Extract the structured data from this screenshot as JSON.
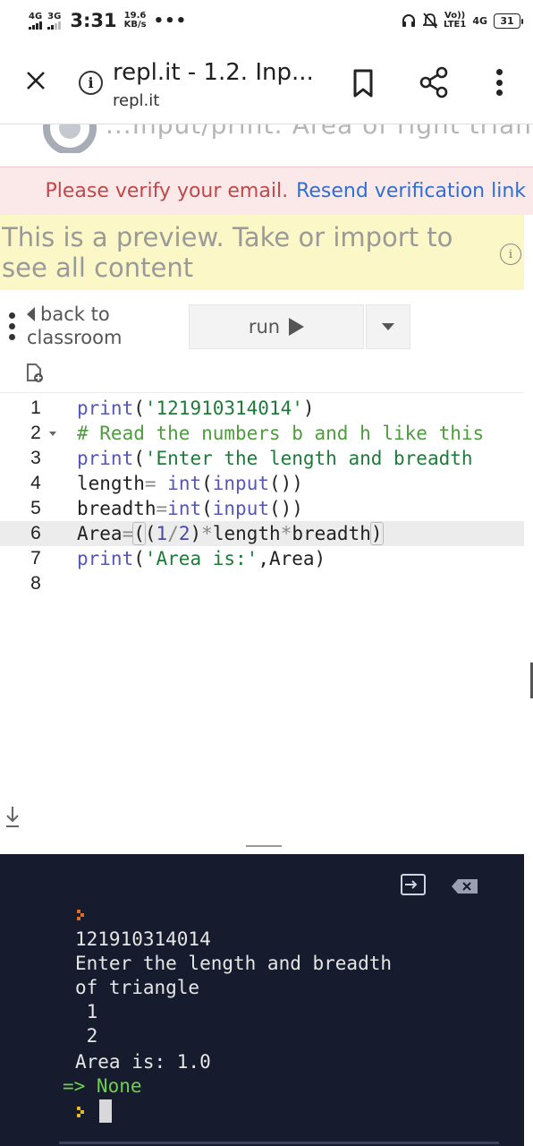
{
  "status_bar": {
    "net1": "4G",
    "net2": "3G",
    "time": "3:31",
    "speed_value": "19.6",
    "speed_unit": "KB/s",
    "more": "•••",
    "volte_top": "Vo))",
    "volte_bottom": "LTE1",
    "net_right": "4G",
    "battery": "31"
  },
  "tab": {
    "title": "repl.it - 1.2. Inp...",
    "url": "repl.it",
    "close_icon": "close-icon",
    "info_icon": "info-icon",
    "info_glyph": "i"
  },
  "header": {
    "remnant_text": "...Input/print: Area of right triang"
  },
  "verify_banner": {
    "message": "Please verify your email.",
    "link": "Resend verification link"
  },
  "preview_banner": {
    "text": "This is a preview. Take or import to see all content",
    "info_glyph": "i"
  },
  "toolbar": {
    "back_label_1": "back to",
    "back_label_2": "classroom",
    "run_label": "run"
  },
  "editor": {
    "line_numbers": [
      "1",
      "2",
      "3",
      "4",
      "5",
      "6",
      "7",
      "8"
    ],
    "active_line": 6,
    "lines": [
      "print('121910314014')",
      "# Read the numbers b and h like this",
      "print('Enter the length and breadth",
      "length= int(input())",
      "breadth=int(input())",
      "Area=((1/2)*length*breadth)",
      "print('Area is:',Area)",
      ""
    ]
  },
  "console": {
    "output": [
      "121910314014",
      "Enter the length and breadth",
      "of triangle",
      " 1",
      " 2",
      "Area is: 1.0"
    ],
    "result": "=> None"
  },
  "colors": {
    "console_bg": "#161c2e",
    "verify_bg": "#fbe9e9",
    "verify_msg": "#c0474a",
    "verify_link": "#2f6fd1",
    "preview_bg": "#fbf7c6",
    "string": "#1f7a3a",
    "function": "#5656b8",
    "comment": "#4f9b3f",
    "result": "#6fcf4a"
  }
}
